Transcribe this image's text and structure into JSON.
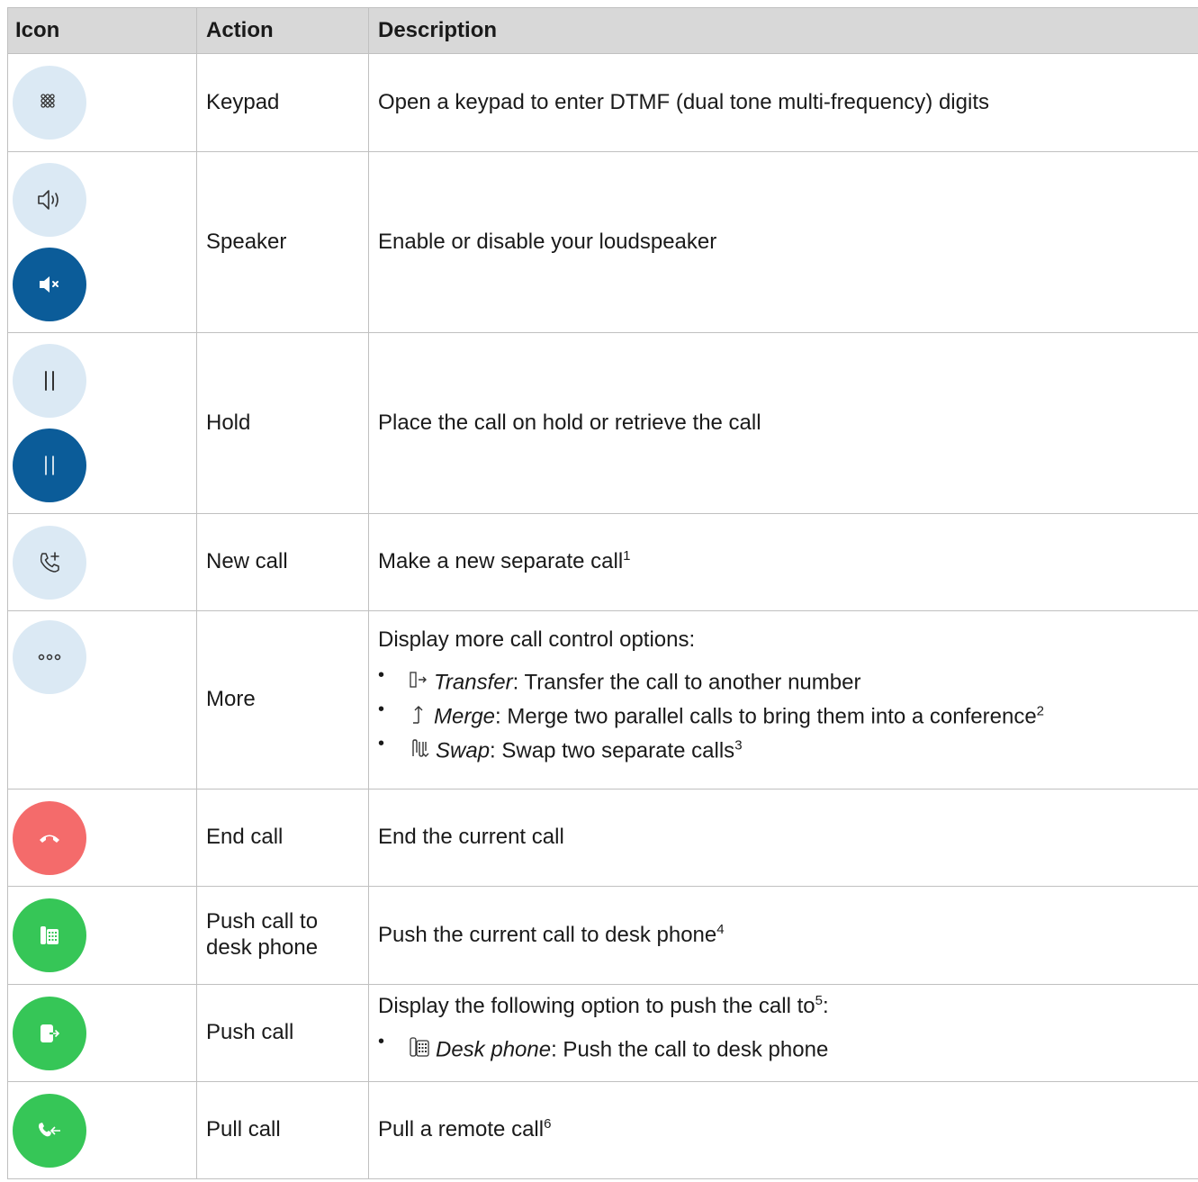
{
  "headers": {
    "icon": "Icon",
    "action": "Action",
    "description": "Description"
  },
  "colors": {
    "light_circle": "#dbe9f4",
    "blue_circle": "#0b5c99",
    "red_circle": "#f46b6b",
    "green_circle": "#36c657",
    "header_bg": "#d8d8d8"
  },
  "rows": [
    {
      "icons": [
        "keypad-icon"
      ],
      "action": "Keypad",
      "description": "Open a keypad to enter DTMF (dual tone multi-frequency) digits"
    },
    {
      "icons": [
        "speaker-icon",
        "speaker-muted-icon"
      ],
      "action": "Speaker",
      "description": "Enable or disable your loudspeaker"
    },
    {
      "icons": [
        "hold-icon",
        "hold-active-icon"
      ],
      "action": "Hold",
      "description": "Place the call on hold or retrieve the call"
    },
    {
      "icons": [
        "new-call-icon"
      ],
      "action": "New call",
      "description": "Make a new separate call",
      "footnote": "1"
    },
    {
      "icons": [
        "more-icon"
      ],
      "action": "More",
      "description": "Display more call control options:",
      "options": [
        {
          "icon": "transfer-icon",
          "name": "Transfer",
          "text": ": Transfer the call to another number",
          "footnote": ""
        },
        {
          "icon": "merge-icon",
          "name": "Merge",
          "text": ": Merge two parallel calls to bring them into a conference",
          "footnote": "2"
        },
        {
          "icon": "swap-icon",
          "name": "Swap",
          "text": ": Swap two separate calls",
          "footnote": "3"
        }
      ]
    },
    {
      "icons": [
        "end-call-icon"
      ],
      "action": "End call",
      "description": "End the current call"
    },
    {
      "icons": [
        "desk-phone-icon"
      ],
      "action": "Push call to desk phone",
      "description": "Push the current call to desk phone",
      "footnote": "4"
    },
    {
      "icons": [
        "push-call-icon"
      ],
      "action": "Push call",
      "description": "Display the following option to push the call to",
      "footnote": "5",
      "suffix": ":",
      "options": [
        {
          "icon": "desk-phone-small-icon",
          "name": "Desk phone",
          "text": ": Push the call to desk phone",
          "footnote": ""
        }
      ]
    },
    {
      "icons": [
        "pull-call-icon"
      ],
      "action": "Pull call",
      "description": "Pull a remote call",
      "footnote": "6"
    }
  ]
}
